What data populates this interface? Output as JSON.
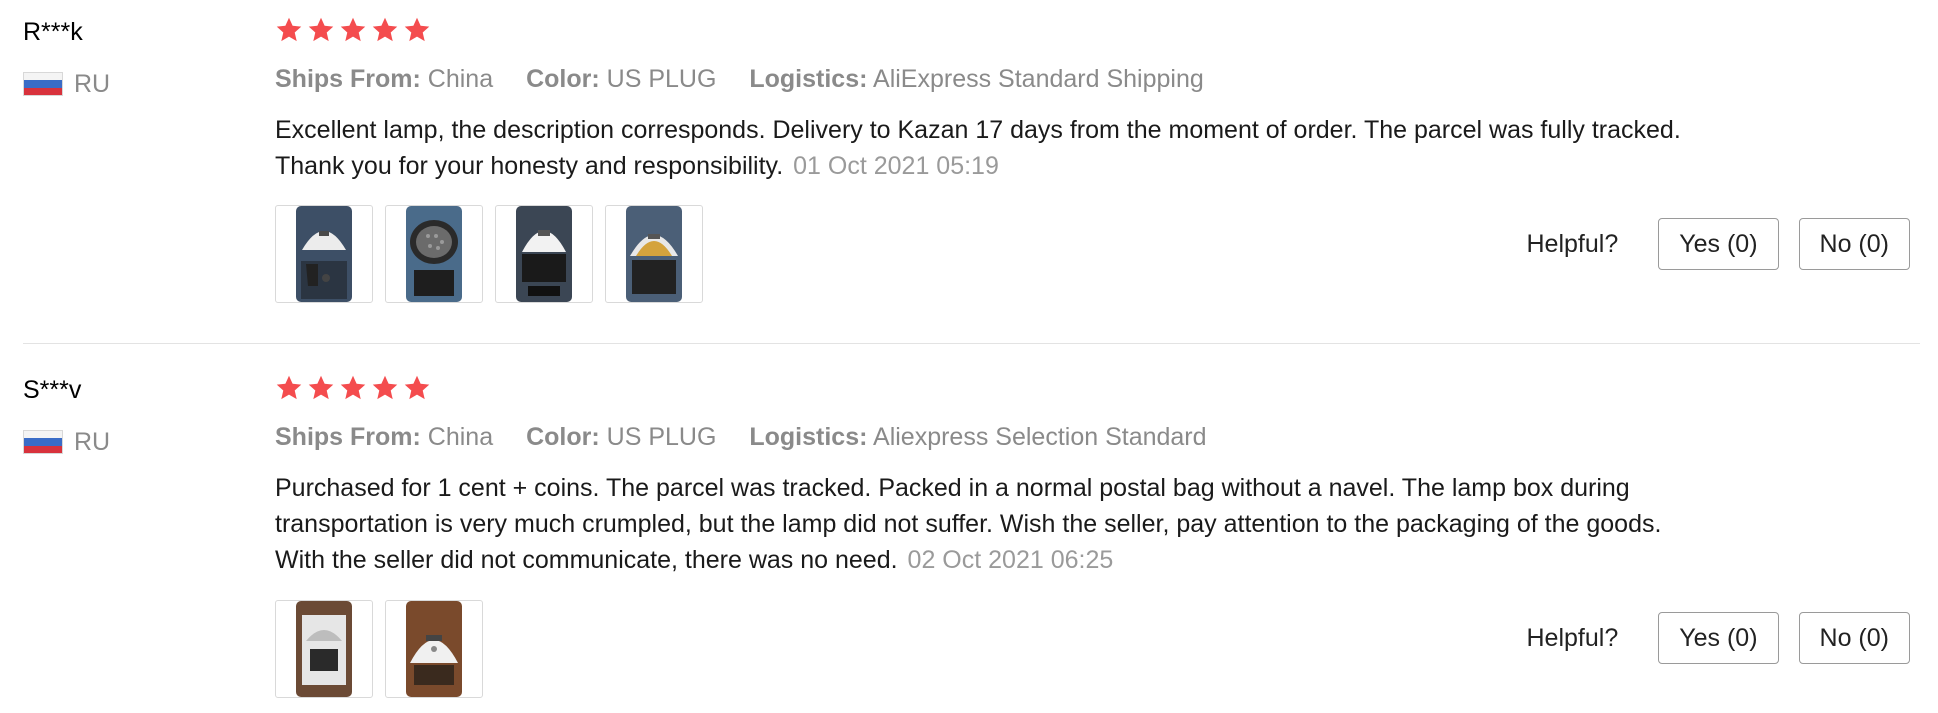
{
  "reviews": [
    {
      "user": "R***k",
      "country": "RU",
      "rating": 5,
      "ships_from_label": "Ships From:",
      "ships_from": "China",
      "color_label": "Color:",
      "color": "US PLUG",
      "logistics_label": "Logistics:",
      "logistics": "AliExpress Standard Shipping",
      "text": "Excellent lamp, the description corresponds. Delivery to Kazan 17 days from the moment of order. The parcel was fully tracked. Thank you for your honesty and responsibility.",
      "date": "01 Oct 2021 05:19",
      "photos": 4,
      "helpful_label": "Helpful?",
      "yes_label": "Yes (0)",
      "no_label": "No (0)"
    },
    {
      "user": "S***v",
      "country": "RU",
      "rating": 5,
      "ships_from_label": "Ships From:",
      "ships_from": "China",
      "color_label": "Color:",
      "color": "US PLUG",
      "logistics_label": "Logistics:",
      "logistics": "Aliexpress Selection Standard",
      "text": "Purchased for 1 cent + coins. The parcel was tracked. Packed in a normal postal bag without a navel. The lamp box during transportation is very much crumpled, but the lamp did not suffer. Wish the seller, pay attention to the packaging of the goods. With the seller did not communicate, there was no need.",
      "date": "02 Oct 2021 06:25",
      "photos": 2,
      "helpful_label": "Helpful?",
      "yes_label": "Yes (0)",
      "no_label": "No (0)"
    }
  ],
  "colors": {
    "star": "#f44c4e",
    "muted_text": "#8a8a8a",
    "date_text": "#9a9a9a",
    "divider": "#e3e3e3"
  },
  "icons": {
    "star": "star-icon",
    "flag": "russia-flag-icon"
  }
}
